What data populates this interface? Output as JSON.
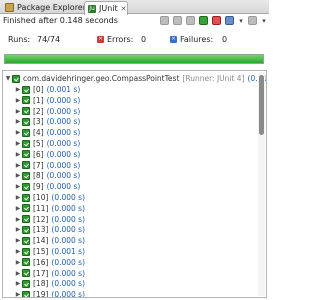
{
  "tabs": [
    {
      "label": "Package Explorer"
    },
    {
      "label": "JUnit"
    }
  ],
  "status_text": "Finished after 0.148 seconds",
  "counters": {
    "runs_label": "Runs:",
    "runs_value": "74/74",
    "errors_label": "Errors:",
    "errors_value": "0",
    "failures_label": "Failures:",
    "failures_value": "0"
  },
  "progress_fraction": 1.0,
  "colors": {
    "progress_fill": "#2ea82e",
    "time_text": "#1f5fae",
    "error_icon": "#d23a3a",
    "failure_icon": "#3a6fc8"
  },
  "tree": {
    "root": {
      "name": "com.davidehringer.geo.CompassPointTest",
      "runner": "[Runner: JUnit 4]",
      "time": "(0.015 s)"
    },
    "items": [
      {
        "name": "[0]",
        "time": "(0.001 s)"
      },
      {
        "name": "[1]",
        "time": "(0.000 s)"
      },
      {
        "name": "[2]",
        "time": "(0.000 s)"
      },
      {
        "name": "[3]",
        "time": "(0.000 s)"
      },
      {
        "name": "[4]",
        "time": "(0.000 s)"
      },
      {
        "name": "[5]",
        "time": "(0.000 s)"
      },
      {
        "name": "[6]",
        "time": "(0.000 s)"
      },
      {
        "name": "[7]",
        "time": "(0.000 s)"
      },
      {
        "name": "[8]",
        "time": "(0.000 s)"
      },
      {
        "name": "[9]",
        "time": "(0.000 s)"
      },
      {
        "name": "[10]",
        "time": "(0.000 s)"
      },
      {
        "name": "[11]",
        "time": "(0.000 s)"
      },
      {
        "name": "[12]",
        "time": "(0.000 s)"
      },
      {
        "name": "[13]",
        "time": "(0.000 s)"
      },
      {
        "name": "[14]",
        "time": "(0.000 s)"
      },
      {
        "name": "[15]",
        "time": "(0.001 s)"
      },
      {
        "name": "[16]",
        "time": "(0.000 s)"
      },
      {
        "name": "[17]",
        "time": "(0.000 s)"
      },
      {
        "name": "[18]",
        "time": "(0.000 s)"
      },
      {
        "name": "[19]",
        "time": "(0.000 s)"
      }
    ]
  }
}
